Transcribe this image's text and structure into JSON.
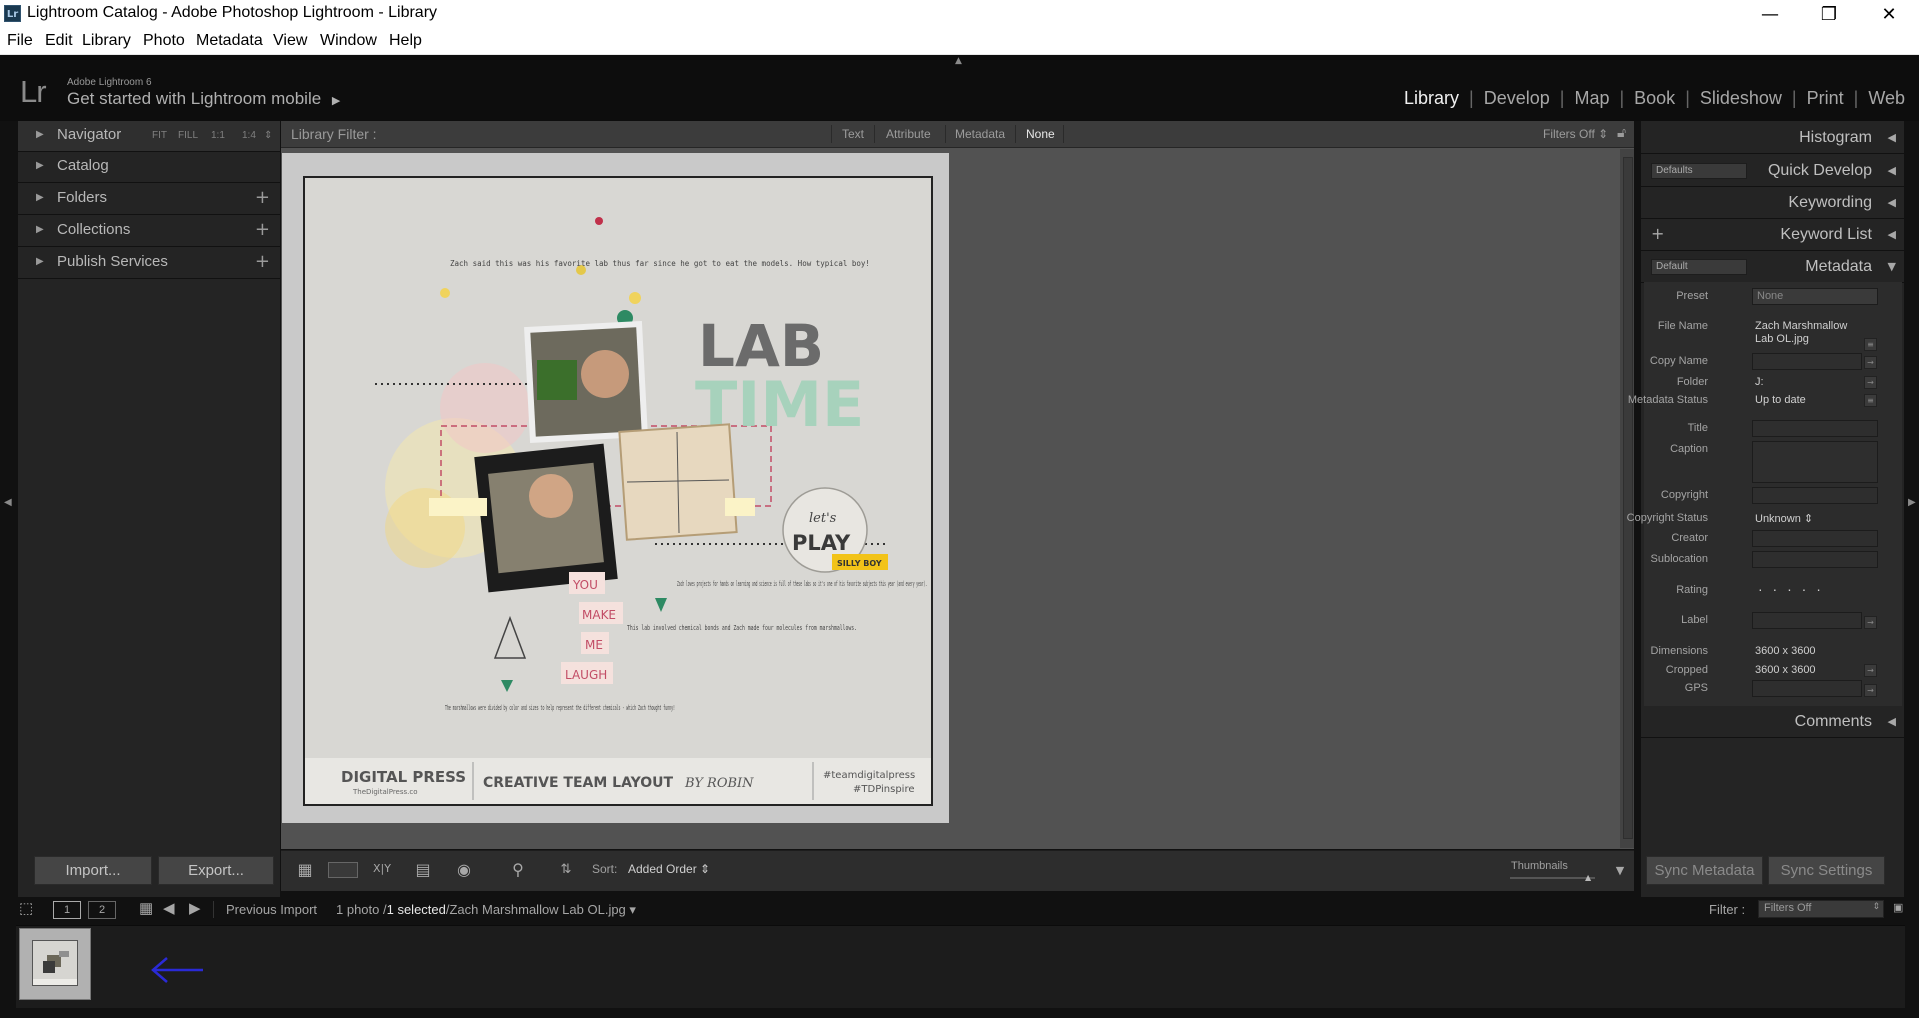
{
  "window": {
    "title": "Lightroom Catalog - Adobe Photoshop Lightroom - Library",
    "app_icon": "Lr",
    "minimize": "—",
    "restore": "❐",
    "close": "✕"
  },
  "menu": [
    "File",
    "Edit",
    "Library",
    "Photo",
    "Metadata",
    "View",
    "Window",
    "Help"
  ],
  "identity": {
    "logo": "Lr",
    "version": "Adobe Lightroom 6",
    "mobile": "Get started with Lightroom mobile",
    "mobile_arrow": "▶"
  },
  "modules": [
    "Library",
    "Develop",
    "Map",
    "Book",
    "Slideshow",
    "Print",
    "Web"
  ],
  "active_module": "Library",
  "left_panel": {
    "navigator": {
      "label": "Navigator",
      "zoom": [
        "FIT",
        "FILL",
        "1:1",
        "1:4"
      ]
    },
    "items": [
      {
        "label": "Catalog"
      },
      {
        "label": "Folders"
      },
      {
        "label": "Collections"
      },
      {
        "label": "Publish Services"
      }
    ],
    "import_label": "Import...",
    "export_label": "Export..."
  },
  "filter_bar": {
    "title": "Library Filter :",
    "options": [
      "Text",
      "Attribute",
      "Metadata",
      "None"
    ],
    "selected": "None",
    "filters_status": "Filters Off"
  },
  "photo": {
    "title_lab": "LAB",
    "title_time": "TIME",
    "journal_top": "Zach said this was his favorite lab thus far since he got to eat the models. How typical boy!",
    "journal_mid": "Zach loves projects for hands on learning and science is full of these labs so it's one of his favorite subjects this year (and every year).",
    "journal_mid2": "This lab involved chemical bonds and Zach made four molecules from marshmallows.",
    "journal_bottom": "The marshmallows were divided by color and sizes to help represent the different chemicals - which Zach thought funny!",
    "tag_words": [
      "YOU",
      "MAKE",
      "ME",
      "LAUGH"
    ],
    "badge_script": "let's",
    "badge_main": "PLAY",
    "badge_tag": "SILLY BOY",
    "footer_brand": "DIGITAL PRESS",
    "footer_url": "TheDigitalPress.co",
    "footer_layout": "CREATIVE TEAM LAYOUT",
    "footer_by": "BY ROBIN",
    "footer_tag1": "#teamdigitalpress",
    "footer_tag2": "#TDPinspire"
  },
  "toolbar": {
    "sort_label": "Sort:",
    "sort_value": "Added Order",
    "thumbnails_label": "Thumbnails"
  },
  "right_panel": {
    "histogram": "Histogram",
    "quick_develop": "Quick Develop",
    "quick_develop_preset": "Defaults",
    "keywording": "Keywording",
    "keyword_list": "Keyword List",
    "metadata": "Metadata",
    "metadata_preset": "Default",
    "comments": "Comments",
    "sync_metadata": "Sync Metadata",
    "sync_settings": "Sync Settings",
    "fields": {
      "preset_label": "Preset",
      "preset_value": "None",
      "filename_label": "File Name",
      "filename_value1": "Zach Marshmallow",
      "filename_value2": "Lab OL.jpg",
      "copyname_label": "Copy Name",
      "folder_label": "Folder",
      "folder_value": "J:",
      "status_label": "Metadata Status",
      "status_value": "Up to date",
      "title_label": "Title",
      "caption_label": "Caption",
      "copyright_label": "Copyright",
      "copystatus_label": "Copyright Status",
      "copystatus_value": "Unknown",
      "creator_label": "Creator",
      "sublocation_label": "Sublocation",
      "rating_label": "Rating",
      "rating_value": "· · · · ·",
      "label_label": "Label",
      "dimensions_label": "Dimensions",
      "dimensions_value": "3600 x 3600",
      "cropped_label": "Cropped",
      "cropped_value": "3600 x 3600",
      "gps_label": "GPS"
    }
  },
  "filmstrip_bar": {
    "page1": "1",
    "page2": "2",
    "source": "Previous Import",
    "count_prefix": "1 photo /",
    "count_selected": "1 selected",
    "count_file": "/Zach Marshmallow Lab OL.jpg",
    "filter_label": "Filter :",
    "filter_value": "Filters Off"
  },
  "colors": {
    "accent_blue": "#2a2ad6",
    "panel": "#242424",
    "workarea": "#525252"
  }
}
